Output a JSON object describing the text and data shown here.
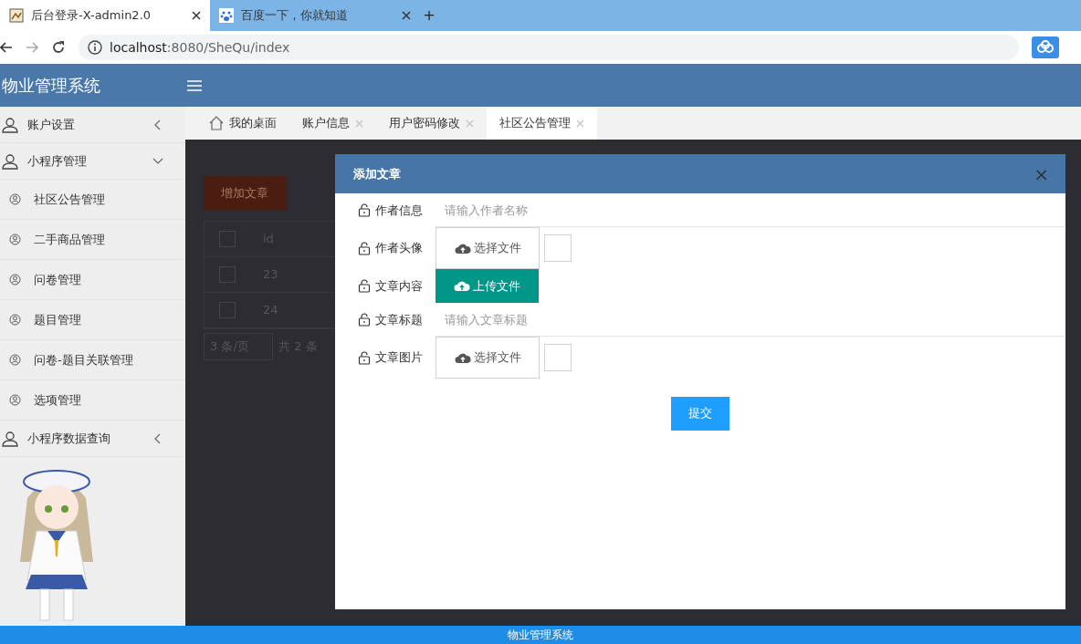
{
  "browser": {
    "tabs": [
      {
        "title": "后台登录-X-admin2.0",
        "selected": true
      },
      {
        "title": "百度一下，你就知道",
        "selected": false
      }
    ],
    "new_tab": "+",
    "address": {
      "host": "localhost",
      "rest": ":8080/SheQu/index"
    }
  },
  "app": {
    "title": "物业管理系统"
  },
  "sidebar": {
    "items": [
      {
        "label": "账户设置",
        "expanded": false
      },
      {
        "label": "小程序管理",
        "expanded": true,
        "children": [
          {
            "label": "社区公告管理"
          },
          {
            "label": "二手商品管理"
          },
          {
            "label": "问卷管理"
          },
          {
            "label": "题目管理"
          },
          {
            "label": "问卷-题目关联管理"
          },
          {
            "label": "选项管理"
          }
        ]
      },
      {
        "label": "小程序数据查询",
        "expanded": false
      }
    ]
  },
  "page_tabs": [
    {
      "label": "我的桌面",
      "kind": "home",
      "selected": false
    },
    {
      "label": "账户信息",
      "kind": "closable",
      "selected": false
    },
    {
      "label": "用户密码修改",
      "kind": "closable",
      "selected": false
    },
    {
      "label": "社区公告管理",
      "kind": "closable",
      "selected": true
    }
  ],
  "background": {
    "add_button": "增加文章",
    "column": "id",
    "header_checked": false,
    "rows": [
      {
        "id": "23",
        "checked": false
      },
      {
        "id": "24",
        "checked": false
      }
    ],
    "page_size": "3 条/页",
    "total": "共 2 条"
  },
  "modal": {
    "title": "添加文章",
    "close": "×",
    "fields": [
      {
        "kind": "text",
        "label": "作者信息",
        "placeholder": "请输入作者名称"
      },
      {
        "kind": "file",
        "label": "作者头像",
        "button": "选择文件"
      },
      {
        "kind": "upload",
        "label": "文章内容",
        "button": "上传文件"
      },
      {
        "kind": "text",
        "label": "文章标题",
        "placeholder": "请输入文章标题"
      },
      {
        "kind": "file",
        "label": "文章图片",
        "button": "选择文件"
      }
    ],
    "submit": "提交"
  },
  "footer": "物业管理系统"
}
